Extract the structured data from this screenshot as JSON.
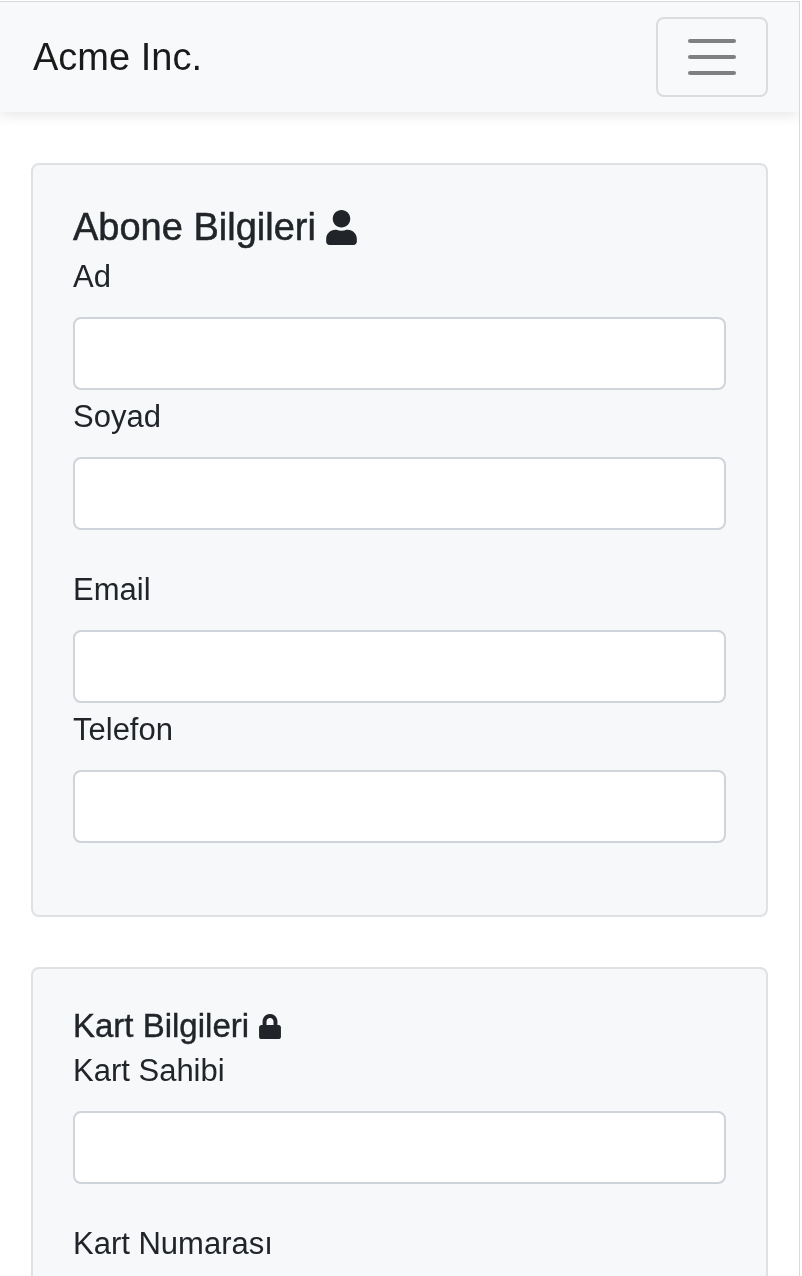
{
  "navbar": {
    "brand": "Acme Inc."
  },
  "sections": [
    {
      "kind": "personal",
      "title": "Abone Bilgileri",
      "groups": [
        {
          "fields": [
            {
              "kind": "input",
              "label": "Ad"
            },
            {
              "kind": "input",
              "label": "Soyad"
            }
          ]
        },
        {
          "fields": [
            {
              "kind": "input",
              "label": "Email"
            },
            {
              "kind": "input",
              "label": "Telefon"
            }
          ]
        }
      ]
    },
    {
      "kind": "payment",
      "title": "Kart Bilgileri",
      "groups": [
        {
          "fields": [
            {
              "kind": "input",
              "label": "Kart Sahibi"
            }
          ]
        },
        {
          "fields": [
            {
              "kind": "label",
              "label": "Kart Numarası"
            }
          ]
        }
      ]
    }
  ]
}
